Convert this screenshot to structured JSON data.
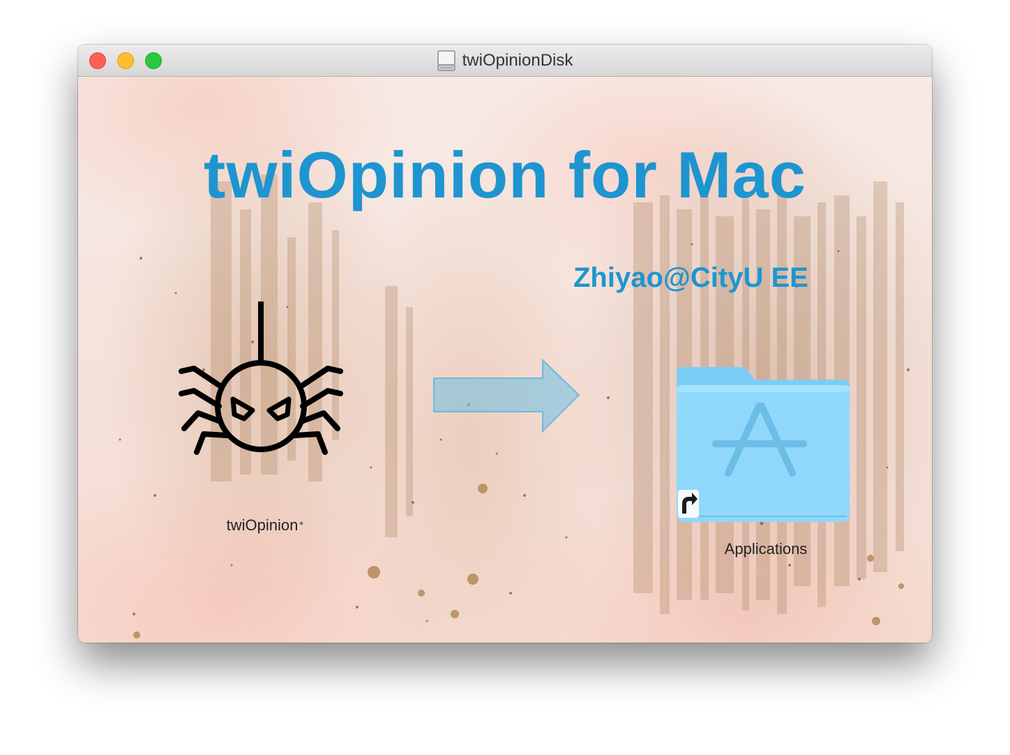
{
  "window": {
    "title": "twiOpinionDisk",
    "controls": {
      "close_color": "#fe5f57",
      "minimize_color": "#febc2e",
      "maximize_color": "#28c840"
    },
    "title_icon": "disk-drive-icon"
  },
  "background": {
    "headline": "twiOpinion for Mac",
    "author": "Zhiyao@CityU EE",
    "text_color": "#1e95d0"
  },
  "items": {
    "app": {
      "label": "twiOpinion",
      "icon": "spider-icon"
    },
    "arrow": {
      "icon": "right-arrow-icon",
      "color": "#6bbfe6"
    },
    "applications": {
      "label": "Applications",
      "icon": "applications-folder-icon",
      "badge": "alias-arrow-icon",
      "color": "#8dd7fb"
    }
  }
}
